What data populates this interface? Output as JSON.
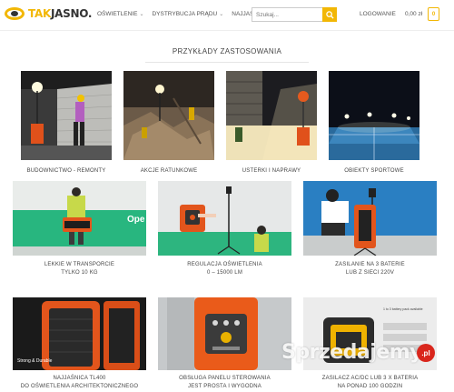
{
  "header": {
    "logo_part1": "TAK",
    "logo_part2": "JASNO.",
    "nav": [
      {
        "label": "OŚWIETLENIE",
        "has_dropdown": true
      },
      {
        "label": "DYSTRYBUCJA PRĄDU",
        "has_dropdown": true
      },
      {
        "label": "NAJJAŚNICE",
        "has_dropdown": false
      }
    ],
    "search_placeholder": "Szukaj...",
    "login_label": "LOGOWANIE",
    "cart_total": "0,00 zł",
    "cart_count": "0",
    "accent_color": "#f2b705"
  },
  "section_title": "PRZYKŁADY ZASTOSOWANIA",
  "row1": [
    {
      "caption": "BUDOWNICTWO - REMONTY"
    },
    {
      "caption": "AKCJE RATUNKOWE"
    },
    {
      "caption": "USTERKI I NAPRAWY"
    },
    {
      "caption": "OBIEKTY SPORTOWE"
    }
  ],
  "row2": [
    {
      "line1": "LEKKIE W TRANSPORCIE",
      "line2": "TYLKO 10 KG",
      "overlay": "Ope"
    },
    {
      "line1": "REGULACJA OŚWIETLENIA",
      "line2": "0 – 15000 LM"
    },
    {
      "line1": "ZASILANIE NA 3 BATERIE",
      "line2": "LUB Z SIECI 220V"
    }
  ],
  "row3": [
    {
      "line1": "NAJJAŚNICA TL400",
      "line2": "DO OŚWIETLENIA ARCHITEKTONICZNEGO",
      "overlay": "Strong & Durable"
    },
    {
      "line1": "OBSŁUGA PANELU STEROWANIA",
      "line2": "JEST PROSTA I WYGODNA"
    },
    {
      "line1": "ZASILACZ AC/DC LUB 3 X BATERIA",
      "line2": "NA PONAD 100 GODZIN",
      "overlay": "1 to 3 battery pack available"
    }
  ],
  "watermark": {
    "text": "Sprzedajemy",
    "badge": ".pl"
  }
}
